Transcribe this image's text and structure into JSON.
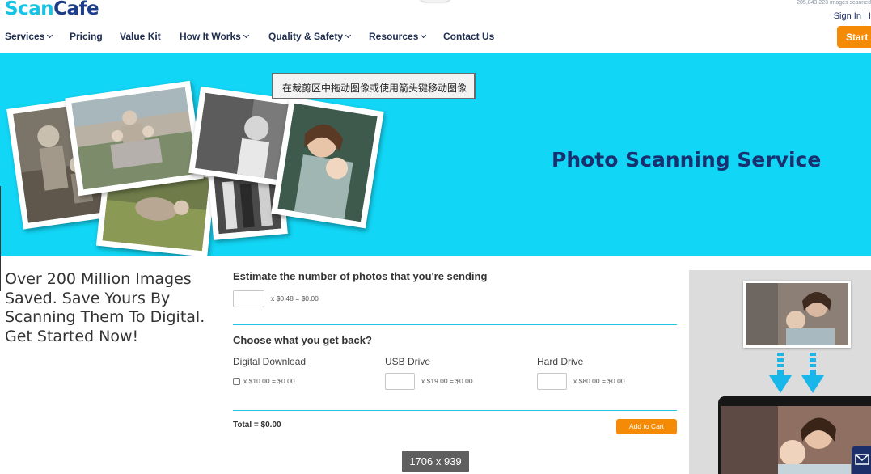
{
  "header": {
    "logo_scan": "Scan",
    "logo_cafe": "Cafe",
    "stat_text": "205,843,223 images scanned",
    "sign_in": "Sign In | I",
    "start_button": "Start"
  },
  "nav": {
    "items": [
      {
        "label": "Services",
        "has_dropdown": true
      },
      {
        "label": "Pricing",
        "has_dropdown": false
      },
      {
        "label": "Value Kit",
        "has_dropdown": false
      },
      {
        "label": "How It Works",
        "has_dropdown": true
      },
      {
        "label": "Quality & Safety",
        "has_dropdown": true
      },
      {
        "label": "Resources",
        "has_dropdown": true
      },
      {
        "label": "Contact Us",
        "has_dropdown": false
      }
    ]
  },
  "hero": {
    "title": "Photo Scanning Service",
    "tooltip": "在裁剪区中拖动图像或使用箭头键移动图像",
    "background_color": "#12d6f5"
  },
  "intro": {
    "text": "Over 200 Million Images Saved. Save Yours By Scanning Them To Digital. Get Started Now!"
  },
  "estimator": {
    "title": "Estimate the number of photos that you're sending",
    "photo_calc": "x $0.48 = $0.00",
    "choose_title": "Choose what you get back?",
    "options": [
      {
        "label": "Digital Download",
        "calc": "x $10.00 = $0.00",
        "control": "checkbox"
      },
      {
        "label": "USB Drive",
        "calc": "x $19.00 = $0.00",
        "control": "input"
      },
      {
        "label": "Hard Drive",
        "calc": "x $80.00 = $0.00",
        "control": "input"
      }
    ],
    "total": "Total = $0.00",
    "add_to_cart": "Add to Cart"
  },
  "overlay": {
    "dimensions": "1706 x 939"
  },
  "colors": {
    "accent_orange": "#f58a07",
    "brand_cyan": "#14c3e6",
    "brand_navy": "#1c3e8a"
  }
}
